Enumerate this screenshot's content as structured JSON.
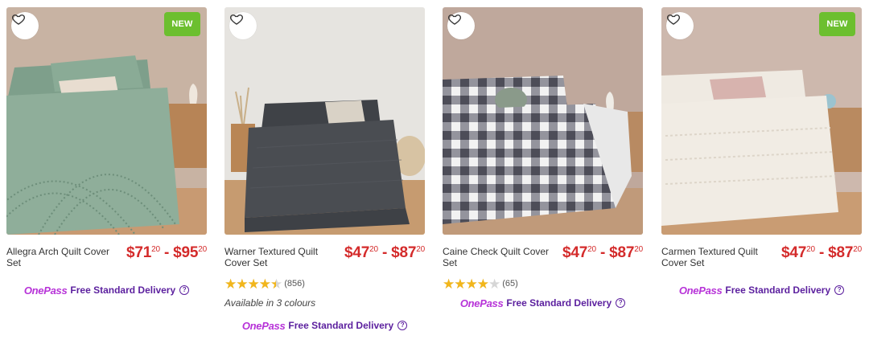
{
  "products": [
    {
      "name": "Allegra Arch Quilt Cover Set",
      "price_from": "$71",
      "price_from_cents": "20",
      "price_sep": " - ",
      "price_to": "$95",
      "price_to_cents": "20",
      "badge": "NEW",
      "rating": null,
      "colours": null,
      "onepass": "OnePass",
      "delivery": "Free Standard Delivery",
      "palette": {
        "wall": "#c8b3a3",
        "floor": "#c89a72",
        "bed": "#8fae9a",
        "pillow": "#e8ddd0"
      }
    },
    {
      "name": "Warner Textured Quilt Cover Set",
      "price_from": "$47",
      "price_from_cents": "20",
      "price_sep": " - ",
      "price_to": "$87",
      "price_to_cents": "20",
      "badge": null,
      "rating": {
        "value": 4.5,
        "count": "(856)"
      },
      "colours": "Available in 3 colours",
      "onepass": "OnePass",
      "delivery": "Free Standard Delivery",
      "palette": {
        "wall": "#e6e4e0",
        "floor": "#c69b70",
        "bed": "#4a4d52",
        "pillow": "#d9d2c6"
      }
    },
    {
      "name": "Caine Check Quilt Cover Set",
      "price_from": "$47",
      "price_from_cents": "20",
      "price_sep": " - ",
      "price_to": "$87",
      "price_to_cents": "20",
      "badge": null,
      "rating": {
        "value": 4,
        "count": "(65)"
      },
      "colours": null,
      "onepass": "OnePass",
      "delivery": "Free Standard Delivery",
      "palette": {
        "wall": "#bfa89c",
        "floor": "#c09a7a",
        "bed": "#5a5a66",
        "pillow": "#8a9a8a"
      }
    },
    {
      "name": "Carmen Textured Quilt Cover Set",
      "price_from": "$47",
      "price_from_cents": "20",
      "price_sep": " - ",
      "price_to": "$87",
      "price_to_cents": "20",
      "badge": "NEW",
      "rating": null,
      "colours": null,
      "onepass": "OnePass",
      "delivery": "Free Standard Delivery",
      "palette": {
        "wall": "#cdb8ad",
        "floor": "#c99c73",
        "bed": "#f1ece4",
        "pillow": "#d7b3ae"
      }
    }
  ],
  "icons": {
    "favourite": "heart-outline-icon",
    "help": "question-circle-icon",
    "rating": "star-icon"
  }
}
